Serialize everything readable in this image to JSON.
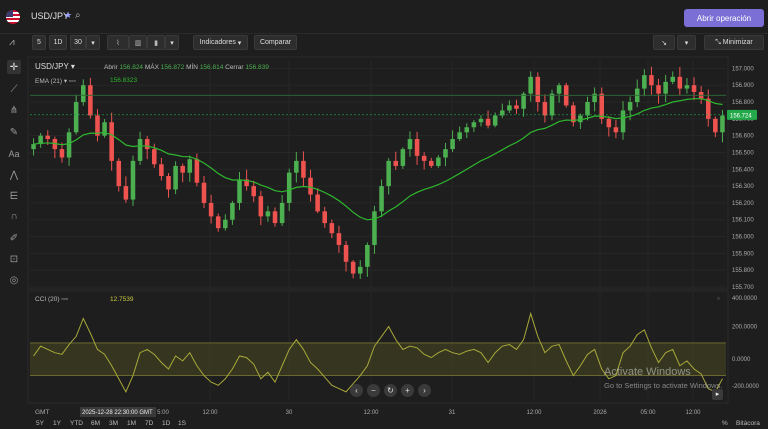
{
  "header": {
    "pair_title": "USD/JPY",
    "open_trade_label": "Abrir operación"
  },
  "toolbar": {
    "interval_5": "5",
    "interval_1d": "1D",
    "interval_30": "30",
    "indicators_label": "Indicadores",
    "compare_label": "Comparar",
    "minimize_label": "Minimizar"
  },
  "legend": {
    "symbol": "USD/JPY",
    "open_label": "Abrir",
    "open_value": "156.824",
    "high_label": "MÁX",
    "high_value": "156.872",
    "low_label": "MÍN",
    "low_value": "156.814",
    "close_label": "Cerrar",
    "close_value": "156.839",
    "ema_label": "EMA (21)",
    "ema_value": "156.8323",
    "cci_label": "CCI (20)",
    "cci_value": "12.7539"
  },
  "colors": {
    "bull": "#4caf50",
    "bear": "#ef5350",
    "ema": "#2eb82e",
    "cci": "#a8a83a",
    "price_tag": "#23a94a"
  },
  "chart_data": {
    "type": "candlestick",
    "price_ticks": [
      "157.000",
      "156.900",
      "156.800",
      "156.700",
      "156.600",
      "156.500",
      "156.400",
      "156.300",
      "156.200",
      "156.100",
      "156.000",
      "155.900",
      "155.800",
      "155.700"
    ],
    "ylim": [
      155.7,
      157.05
    ],
    "current_price": "156.724",
    "x_labels": [
      "12:00",
      "30",
      "12:00",
      "31",
      "12:00",
      "2026",
      "05:00",
      "12:00"
    ],
    "x_label_highlight": "2025-12-28 22:30:00 GMT",
    "x_label_partial": "5:00",
    "cci_ticks": [
      "400.0000",
      "200.0000",
      "0.0000",
      "-200.0000"
    ],
    "cci_ylim": [
      -250,
      400
    ],
    "cci_band": [
      -100,
      100
    ],
    "price_path": [
      156.55,
      156.6,
      156.58,
      156.52,
      156.47,
      156.62,
      156.8,
      156.9,
      156.72,
      156.6,
      156.68,
      156.45,
      156.3,
      156.22,
      156.45,
      156.58,
      156.52,
      156.43,
      156.36,
      156.28,
      156.42,
      156.38,
      156.46,
      156.32,
      156.2,
      156.12,
      156.05,
      156.1,
      156.2,
      156.34,
      156.3,
      156.24,
      156.12,
      156.15,
      156.08,
      156.2,
      156.38,
      156.45,
      156.35,
      156.25,
      156.15,
      156.08,
      156.02,
      155.95,
      155.85,
      155.78,
      155.82,
      155.95,
      156.15,
      156.3,
      156.45,
      156.42,
      156.52,
      156.58,
      156.48,
      156.45,
      156.42,
      156.47,
      156.52,
      156.58,
      156.62,
      156.65,
      156.68,
      156.7,
      156.66,
      156.72,
      156.75,
      156.78,
      156.76,
      156.85,
      156.95,
      156.8,
      156.72,
      156.85,
      156.9,
      156.78,
      156.68,
      156.72,
      156.8,
      156.85,
      156.7,
      156.65,
      156.62,
      156.75,
      156.8,
      156.88,
      156.96,
      156.9,
      156.85,
      156.92,
      156.95,
      156.88,
      156.9,
      156.86,
      156.82,
      156.7,
      156.62,
      156.72
    ],
    "cci_path": [
      20,
      80,
      60,
      40,
      30,
      90,
      140,
      250,
      160,
      60,
      30,
      -40,
      -120,
      -200,
      -100,
      40,
      60,
      30,
      -20,
      -60,
      20,
      -10,
      40,
      -40,
      -100,
      -140,
      -160,
      -120,
      -60,
      20,
      10,
      -30,
      -120,
      -80,
      -140,
      -40,
      60,
      120,
      60,
      -20,
      -60,
      -110,
      -160,
      -180,
      -200,
      -150,
      -100,
      -40,
      80,
      140,
      200,
      120,
      60,
      80,
      70,
      30,
      10,
      40,
      60,
      40,
      30,
      50,
      60,
      40,
      -20,
      40,
      80,
      90,
      60,
      120,
      280,
      140,
      40,
      80,
      90,
      -10,
      -100,
      -40,
      30,
      60,
      -60,
      -120,
      -100,
      40,
      80,
      150,
      180,
      70,
      -20,
      40,
      60,
      -40,
      -10,
      -60,
      -90,
      -180,
      -200,
      -120
    ]
  }
}
